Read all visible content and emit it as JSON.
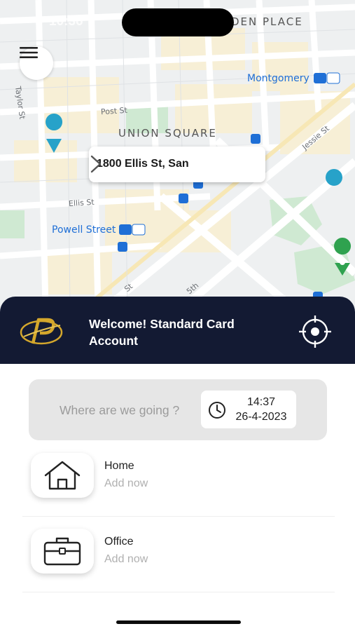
{
  "status_bar": {
    "time": "10:36"
  },
  "map": {
    "labels": {
      "top_place": "DEN PLACE",
      "montgomery": "Montgomery",
      "post_st": "Post St",
      "taylor_st": "Taylor St",
      "union_square": "UNION SQUARE",
      "jessie_st": "Jessie St",
      "ellis_st": "Ellis St",
      "powell_street": "Powell Street",
      "fifth_st": "5th",
      "sixth_st": "St"
    },
    "address_card": {
      "text": "1800 Ellis St, San"
    }
  },
  "header_panel": {
    "welcome_text": "Welcome! Standard Card Account",
    "brand_color": "#131a33",
    "logo_accent": "#d4a72c"
  },
  "search": {
    "placeholder": "Where are we going ?",
    "time": "14:37",
    "date": "26-4-2023"
  },
  "saved_places": [
    {
      "title": "Home",
      "subtitle": "Add now",
      "icon": "house-icon"
    },
    {
      "title": "Office",
      "subtitle": "Add now",
      "icon": "briefcase-icon"
    }
  ]
}
